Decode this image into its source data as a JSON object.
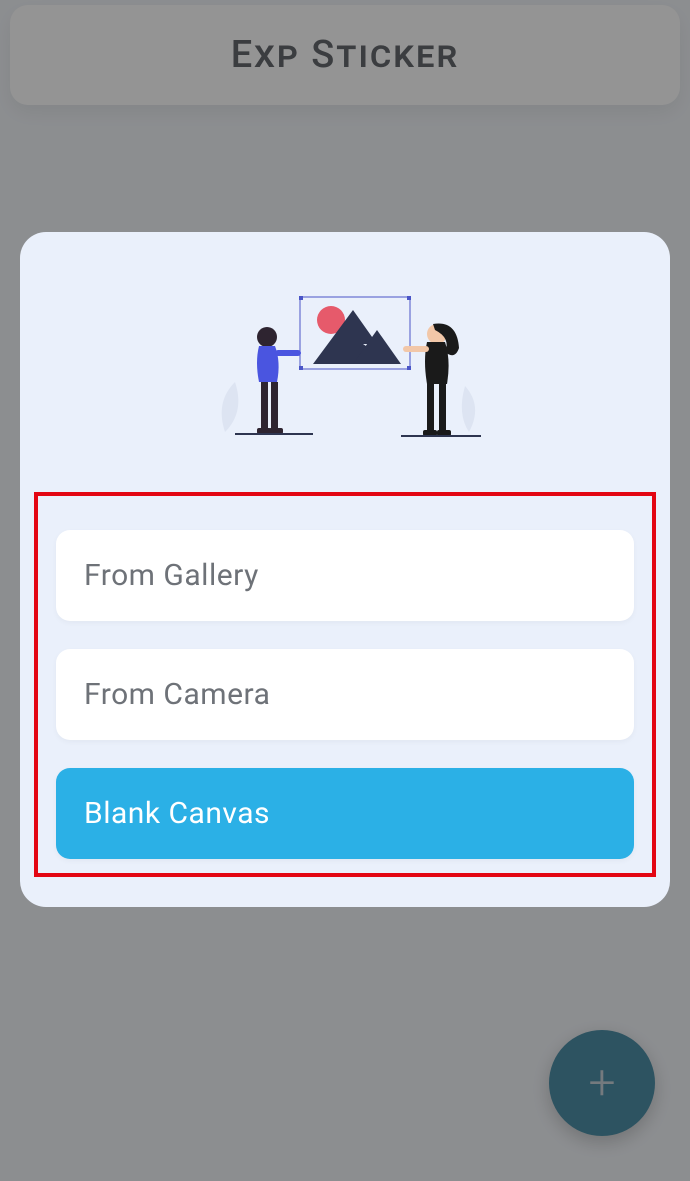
{
  "header": {
    "title": "Exp Sticker"
  },
  "fab": {
    "icon_glyph": "+"
  },
  "sheet": {
    "options": [
      {
        "label": "From Gallery",
        "variant": "light"
      },
      {
        "label": "From Camera",
        "variant": "light"
      },
      {
        "label": "Blank Canvas",
        "variant": "primary"
      }
    ]
  }
}
